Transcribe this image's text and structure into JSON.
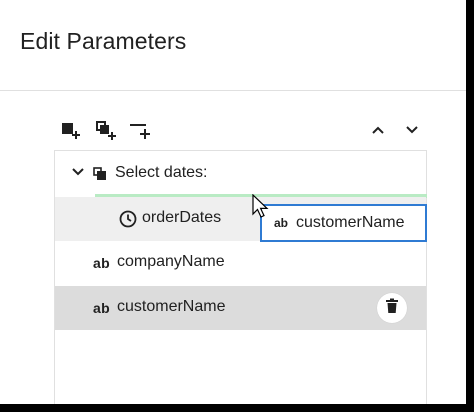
{
  "dialog": {
    "title": "Edit Parameters"
  },
  "toolbar": {
    "icons": [
      "add-parameter-icon",
      "add-group-icon",
      "add-separator-icon",
      "move-up-icon",
      "move-down-icon"
    ]
  },
  "tree": {
    "group": {
      "label": "Select dates:",
      "expanded": true
    },
    "items": [
      {
        "label": "orderDates",
        "type": "date",
        "icon": "clock-icon"
      },
      {
        "label": "companyName",
        "type": "string",
        "icon_text": "ab"
      },
      {
        "label": "customerName",
        "type": "string",
        "icon_text": "ab",
        "selected": true
      }
    ]
  },
  "drag_preview": {
    "label": "customerName",
    "icon_text": "ab"
  },
  "colors": {
    "drop_indicator": "#b9ebc4",
    "drag_border": "#2f7bd3",
    "selected_row": "#dcdcdc"
  }
}
